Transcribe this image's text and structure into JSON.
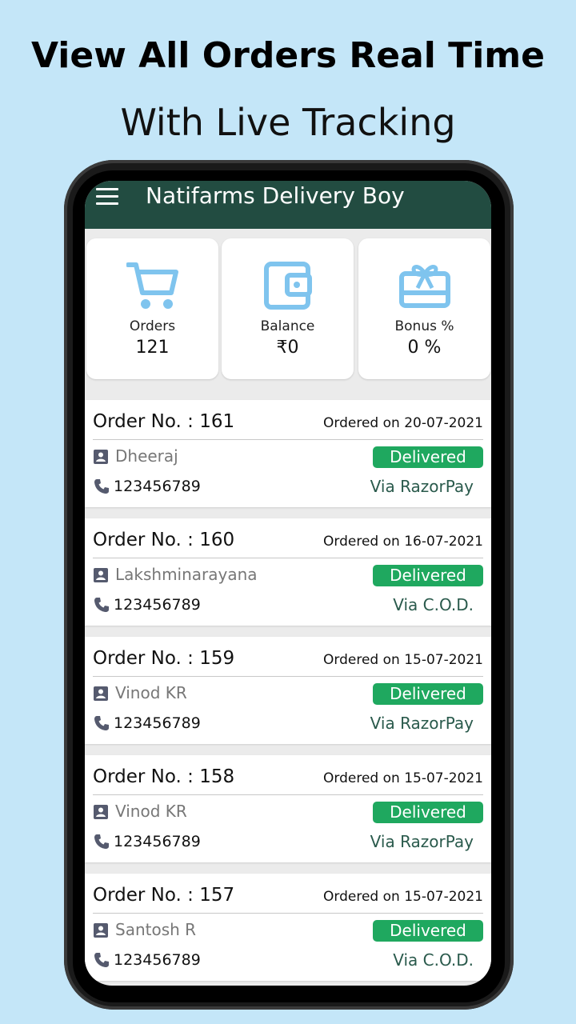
{
  "promo": {
    "headline": "View All Orders Real Time",
    "subline": "With Live Tracking"
  },
  "app": {
    "title": "Natifarms Delivery Boy",
    "theme_color": "#224c41",
    "accent_color": "#1fa85f",
    "icon_color": "#7fc4ee"
  },
  "stats": [
    {
      "label": "Orders",
      "value": "121",
      "icon": "cart-icon"
    },
    {
      "label": "Balance",
      "value": "₹0",
      "icon": "wallet-icon"
    },
    {
      "label": "Bonus %",
      "value": "0 %",
      "icon": "gift-card-icon"
    }
  ],
  "orders": [
    {
      "order_no": "Order No. : 161",
      "date": "Ordered on 20-07-2021",
      "name": "Dheeraj",
      "status": "Delivered",
      "phone": "123456789",
      "payment": "Via RazorPay"
    },
    {
      "order_no": "Order No. : 160",
      "date": "Ordered on 16-07-2021",
      "name": "Lakshminarayana",
      "status": "Delivered",
      "phone": "123456789",
      "payment": "Via C.O.D."
    },
    {
      "order_no": "Order No. : 159",
      "date": "Ordered on 15-07-2021",
      "name": "Vinod KR",
      "status": "Delivered",
      "phone": "123456789",
      "payment": "Via RazorPay"
    },
    {
      "order_no": "Order No. : 158",
      "date": "Ordered on 15-07-2021",
      "name": "Vinod KR",
      "status": "Delivered",
      "phone": "123456789",
      "payment": "Via RazorPay"
    },
    {
      "order_no": "Order No. : 157",
      "date": "Ordered on 15-07-2021",
      "name": "Santosh R",
      "status": "Delivered",
      "phone": "123456789",
      "payment": "Via C.O.D."
    }
  ]
}
